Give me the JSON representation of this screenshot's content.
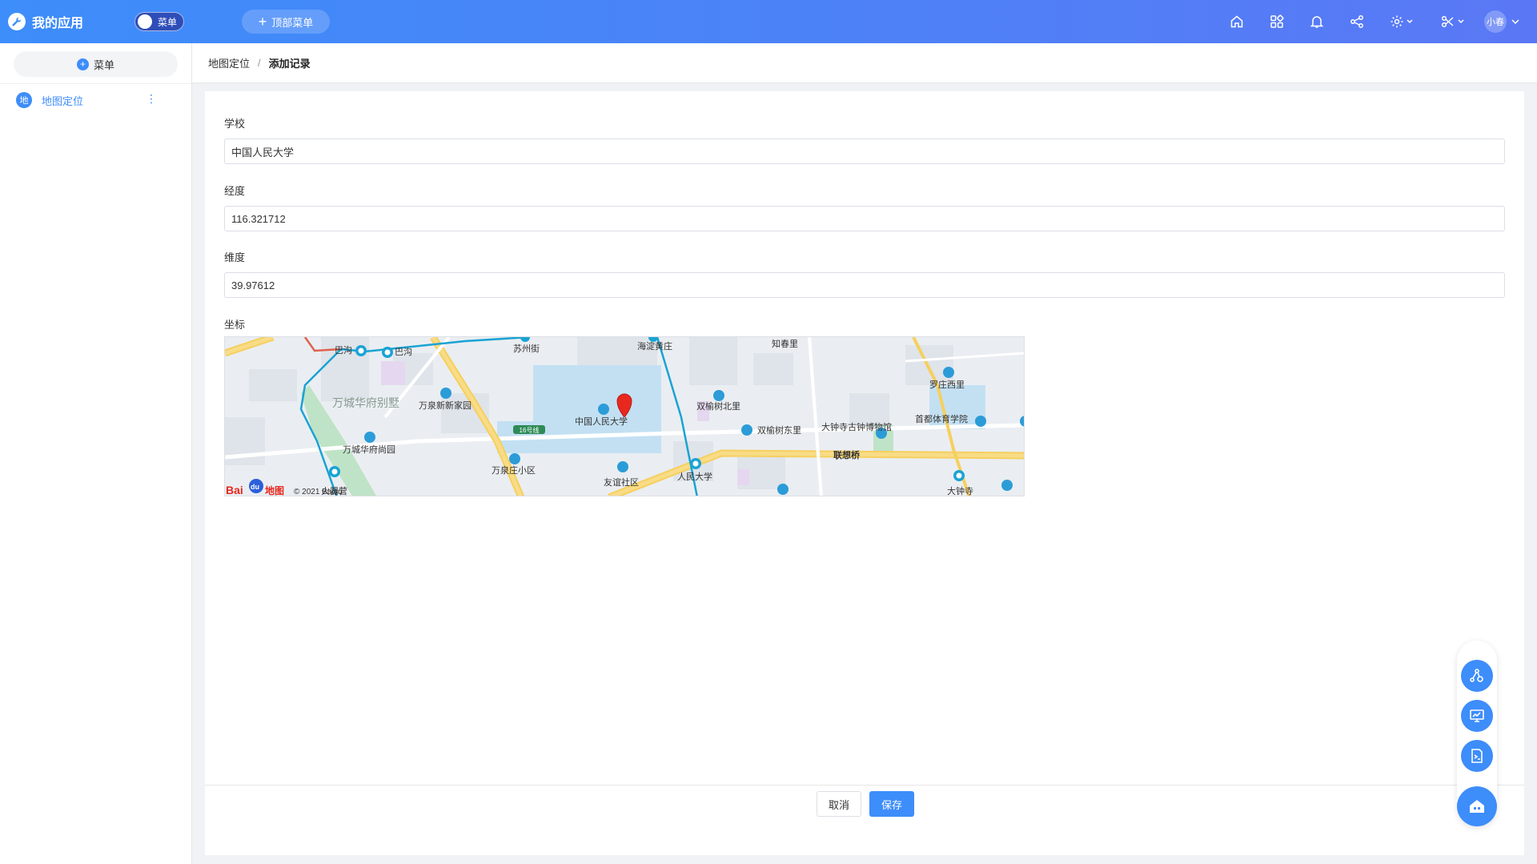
{
  "header": {
    "app_title": "我的应用",
    "toggle_label": "菜单",
    "top_menu_label": "顶部菜单",
    "user_name": "小春",
    "icons": [
      "home-icon",
      "apps-icon",
      "bell-icon",
      "share-icon",
      "settings-icon",
      "tools-icon"
    ]
  },
  "sidebar": {
    "menu_button_label": "菜单",
    "items": [
      {
        "badge": "地",
        "label": "地图定位",
        "more": "⋮"
      }
    ]
  },
  "breadcrumb": {
    "parent": "地图定位",
    "separator": "/",
    "current": "添加记录"
  },
  "form": {
    "school": {
      "label": "学校",
      "value": "中国人民大学"
    },
    "longitude": {
      "label": "经度",
      "value": "116.321712"
    },
    "latitude": {
      "label": "维度",
      "value": "39.97612"
    },
    "coordinate": {
      "label": "坐标"
    }
  },
  "map": {
    "labels": {
      "bagou1": "巴沟",
      "bagou2": "巴沟",
      "suzhoujie": "苏州街",
      "haidianhuangzhuang": "海淀黄庄",
      "zhichunli": "知春里",
      "luozhuangxili": "罗庄西里",
      "wanchenghuafubieshu": "万城华府别墅",
      "wanquanxinxinjiayuan": "万泉新新家园",
      "renmindaxue_campus": "中国人民大学",
      "line16": "16号线",
      "shuangyushubeili": "双榆树北里",
      "shuangyushudongli": "双榆树东里",
      "dazhongsi_museum": "大钟寺古钟博物馆",
      "shoudu_tiyu": "首都体育学院",
      "wanchenghuafushangyuan": "万城华府尚园",
      "wanquanzhuang": "万泉庄小区",
      "youyishequ": "友谊社区",
      "renmindaxue_station": "人民大学",
      "lianxiangqiao": "联想桥",
      "dazhongsi": "大钟寺",
      "huoqiying": "火器营",
      "copyright": "© 2021 Baidu",
      "baidu_logo_text": "Bai",
      "baidu_logo_du": "du",
      "baidu_logo_map": "地图"
    },
    "marker_color": "#e8281e"
  },
  "actions": {
    "cancel_label": "取消",
    "save_label": "保存"
  },
  "floating_tools": [
    "share-settings-icon",
    "monitor-icon",
    "terminal-icon",
    "home-building-icon"
  ],
  "colors": {
    "primary": "#3d8dfa",
    "header_gradient_start": "#3d8dfa",
    "header_gradient_end": "#5a78f5"
  }
}
